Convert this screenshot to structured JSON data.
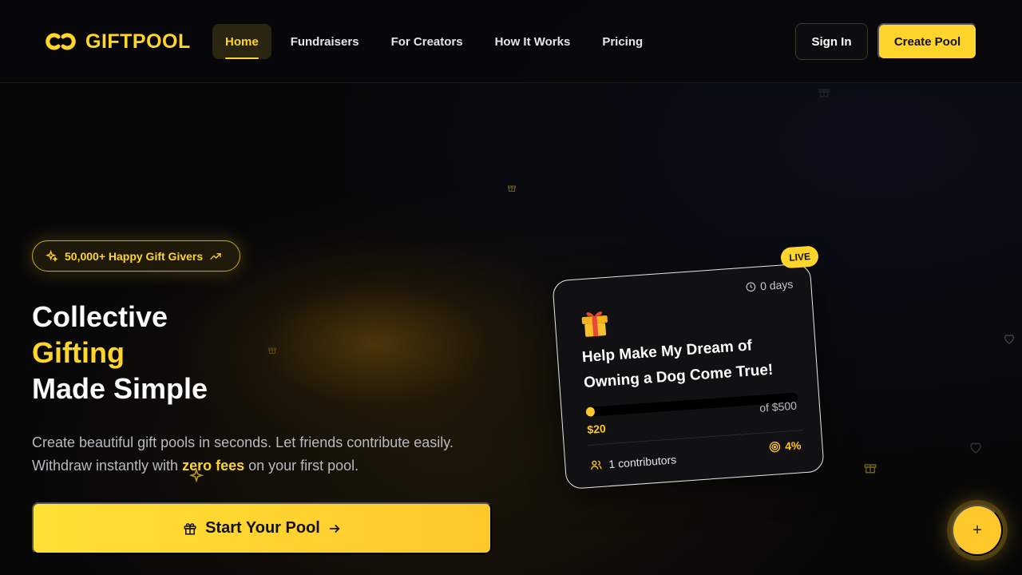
{
  "brand": {
    "name": "GIFTPOOL",
    "accent": "#ffd52b"
  },
  "nav": {
    "items": [
      {
        "label": "Home",
        "active": true
      },
      {
        "label": "Fundraisers",
        "active": false
      },
      {
        "label": "For Creators",
        "active": false
      },
      {
        "label": "How It Works",
        "active": false
      },
      {
        "label": "Pricing",
        "active": false
      }
    ],
    "sign_in": "Sign In",
    "create_pool": "Create Pool"
  },
  "hero": {
    "badge": "50,000+ Happy Gift Givers",
    "title_line1": "Collective",
    "title_line2": "Gifting",
    "title_line3": "Made Simple",
    "subtitle_part1": "Create beautiful gift pools in seconds. Let friends contribute easily. Withdraw instantly with ",
    "subtitle_highlight": "zero fees",
    "subtitle_part2": " on your first pool.",
    "cta": "Start Your Pool"
  },
  "card": {
    "live": "LIVE",
    "days": "0 days",
    "title": "Help Make My Dream of Owning a Dog Come True!",
    "raised": "$20",
    "goal": "of $500",
    "progress_percent": 4,
    "contributors": "1 contributors",
    "percent_label": "4%"
  },
  "fab": {
    "label": "+"
  }
}
